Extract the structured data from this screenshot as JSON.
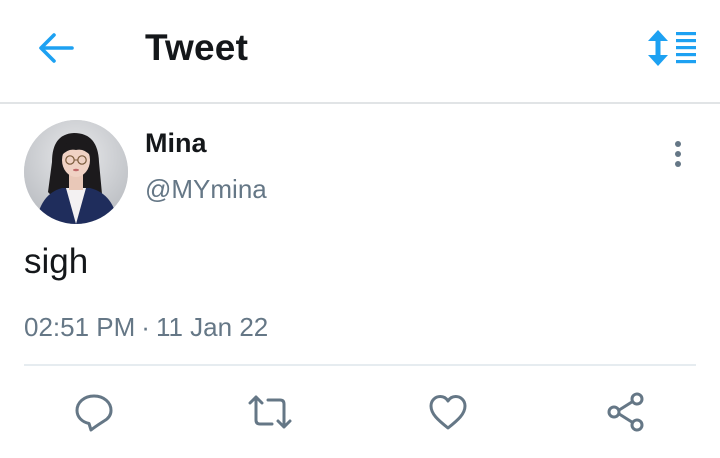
{
  "header": {
    "title": "Tweet",
    "back_icon": "arrow-left-icon",
    "sort_icon": "sort-list-icon",
    "accent_color": "#1da1f2"
  },
  "tweet": {
    "author": {
      "display_name": "Mina",
      "handle": "@MYmina"
    },
    "text": "sigh",
    "time": "02:51 PM",
    "separator": "·",
    "date": "11 Jan 22"
  },
  "actions": {
    "reply_icon": "comment-icon",
    "retweet_icon": "retweet-icon",
    "like_icon": "heart-icon",
    "share_icon": "share-icon"
  },
  "colors": {
    "text_primary": "#14171a",
    "text_secondary": "#657786",
    "divider": "#e6ecf0"
  }
}
